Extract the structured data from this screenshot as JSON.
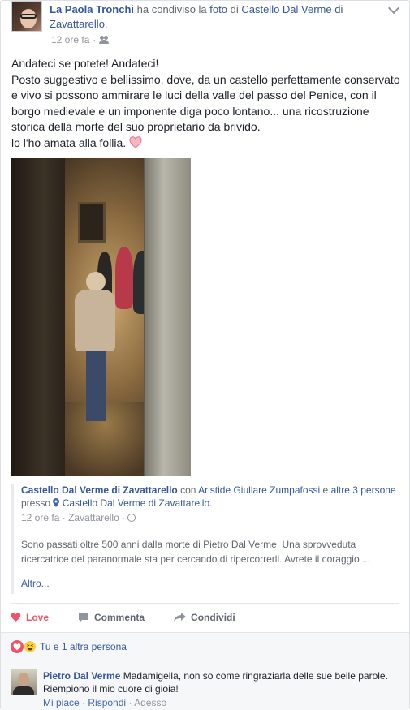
{
  "post": {
    "author": "La Paola Tronchi",
    "shared_text": "ha condiviso la",
    "photo_word": "foto",
    "of_text": "di",
    "page_name": "Castello Dal Verme di Zavattarello",
    "period": ".",
    "time": "12 ore fa",
    "dot": "·",
    "text_lines": [
      "Andateci se potete! Andateci!",
      "Posto suggestivo e bellissimo, dove, da un castello perfettamente conservato e vivo si possono ammirare le luci della valle del passo del Penice, con il borgo medievale e un imponente diga poco lontano... una ricostruzione storica della morte del suo proprietario da brivido.",
      "lo l'ho amata alla follia."
    ]
  },
  "story": {
    "page": "Castello Dal Verme di Zavattarello",
    "with": "con",
    "tagged": "Aristide Giullare Zumpafossi",
    "and": "e",
    "others": "altre 3 persone",
    "at": "presso",
    "place": "Castello Dal Verme di Zavattarello.",
    "time": "12 ore fa",
    "dot": "·",
    "location": "Zavattarello",
    "dot2": "·",
    "description": "Sono passati oltre 500 anni dalla morte di Pietro Dal Verme. Una sprovveduta ricercatrice del paranormale sta per cercando di ripercorrerli. Avrete il coraggio ...",
    "more": "Altro..."
  },
  "actions": {
    "love": "Love",
    "comment": "Commenta",
    "share": "Condividi"
  },
  "reactions": {
    "summary": "Tu e 1 altra persona"
  },
  "comment": {
    "author": "Pietro Dal Verme",
    "text": "Madamigella, non so come ringraziarla delle sue belle parole. Riempiono il mio cuore di gioia!",
    "like": "Mi piace",
    "sep1": "·",
    "reply": "Rispondi",
    "sep2": "·",
    "time": "Adesso"
  },
  "colors": {
    "link": "#365899",
    "love": "#f25268",
    "meta": "#90949c"
  }
}
